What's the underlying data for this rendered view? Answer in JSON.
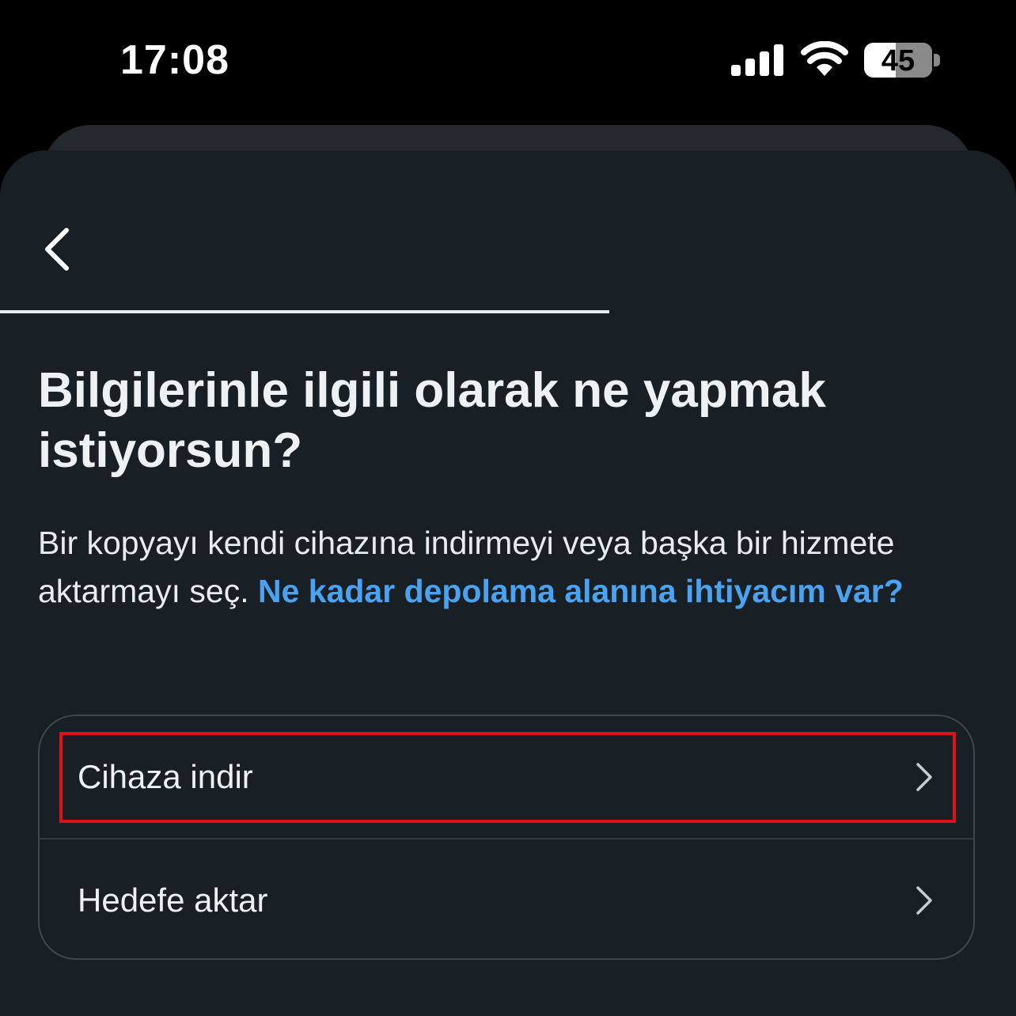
{
  "status_bar": {
    "time": "17:08",
    "battery_level": "45",
    "signal_icon": "cellular-signal-icon",
    "wifi_icon": "wifi-icon"
  },
  "header": {
    "back_icon": "chevron-left-icon",
    "progress_fraction": 0.6
  },
  "main": {
    "title": "Bilgilerinle ilgili olarak ne yapmak istiyorsun?",
    "description": "Bir kopyayı kendi cihazına indirmeyi veya başka bir hizmete aktarmayı seç. ",
    "description_link": "Ne kadar depolama alanına ihtiyacım var?",
    "options": [
      {
        "label": "Cihaza indir",
        "icon": "chevron-right-icon"
      },
      {
        "label": "Hedefe aktar",
        "icon": "chevron-right-icon"
      }
    ]
  },
  "colors": {
    "background": "#182026",
    "link": "#4aa3f0",
    "highlight": "#e0101a"
  }
}
